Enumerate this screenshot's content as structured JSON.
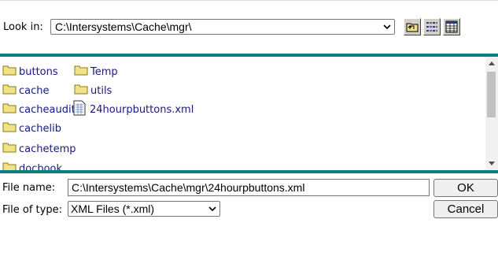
{
  "look_in": {
    "label": "Look in:",
    "value": "C:\\Intersystems\\Cache\\mgr\\"
  },
  "toolbar": {
    "buttons": [
      {
        "icon": "up-folder-icon"
      },
      {
        "icon": "list-view-icon"
      },
      {
        "icon": "details-view-icon"
      }
    ]
  },
  "files": [
    {
      "name": "buttons",
      "type": "folder"
    },
    {
      "name": "cache",
      "type": "folder"
    },
    {
      "name": "cacheaudit",
      "type": "folder"
    },
    {
      "name": "cachelib",
      "type": "folder"
    },
    {
      "name": "cachetemp",
      "type": "folder"
    },
    {
      "name": "docbook",
      "type": "folder"
    },
    {
      "name": "Temp",
      "type": "folder"
    },
    {
      "name": "utils",
      "type": "folder"
    },
    {
      "name": "24hourpbuttons.xml",
      "type": "file"
    }
  ],
  "file_name": {
    "label": "File name:",
    "value": "C:\\Intersystems\\Cache\\mgr\\24hourpbuttons.xml"
  },
  "file_type": {
    "label": "File of type:",
    "value": "XML Files (*.xml)"
  },
  "buttons": {
    "ok": "OK",
    "cancel": "Cancel"
  }
}
